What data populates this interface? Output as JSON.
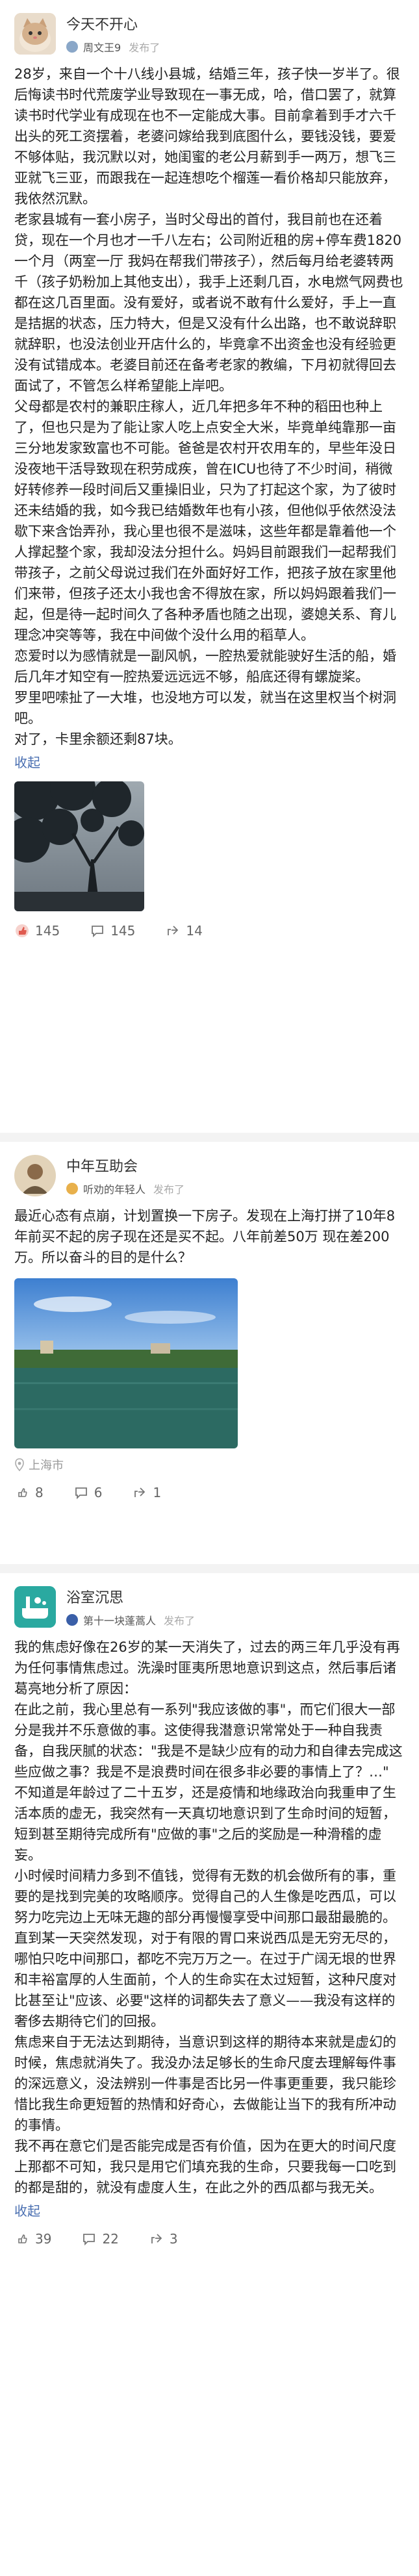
{
  "posts": [
    {
      "username": "今天不开心",
      "subtitle": "周文王9",
      "published": "发布了",
      "text": "28岁，来自一个十八线小县城，结婚三年，孩子快一岁半了。很后悔读书时代荒废学业导致现在一事无成，哈，借口罢了，就算读书时代学业有成现在也不一定能成大事。目前拿着到手才六千出头的死工资摆着，老婆问嫁给我到底图什么，要钱没钱，要爱不够体贴，我沉默以对，她闺蜜的老公月薪到手一两万，想飞三亚就飞三亚，而跟我在一起连想吃个榴莲一看价格却只能放弃，我依然沉默。\n老家县城有一套小房子，当时父母出的首付，我目前也在还着贷，现在一个月也才一千八左右；公司附近租的房+停车费1820一个月（两室一厅 我妈在帮我们带孩子），然后每月给老婆转两千（孩子奶粉加上其他支出），我手上还剩几百，水电燃气网费也都在这几百里面。没有爱好，或者说不敢有什么爱好，手上一直是拮据的状态，压力特大，但是又没有什么出路，也不敢说辞职就辞职，也没法创业开店什么的，毕竟拿不出资金也没有经验更没有试错成本。老婆目前还在备考老家的教编，下月初就得回去面试了，不管怎么样希望能上岸吧。\n父母都是农村的兼职庄稼人，近几年把多年不种的稻田也种上了，但也只是为了能让家人吃上点安全大米，毕竟单纯靠那一亩三分地发家致富也不可能。爸爸是农村开农用车的，早些年没日没夜地干活导致现在积劳成疾，曾在ICU也待了不少时间，稍微好转修养一段时间后又重操旧业，只为了打起这个家，为了彼时还未结婚的我，如今我已结婚数年也有小孩，但他似乎依然没法歇下来含饴弄孙，我心里也很不是滋味，这些年都是靠着他一个人撑起整个家，我却没法分担什么。妈妈目前跟我们一起帮我们带孩子，之前父母说过我们在外面好好工作，把孩子放在家里他们来带，但孩子还太小我也舍不得放在家，所以妈妈跟着我们一起，但是待一起时间久了各种矛盾也随之出现，婆媳关系、育儿理念冲突等等，我在中间做个没什么用的稻草人。\n恋爱时以为感情就是一副风帆，一腔热爱就能驶好生活的船，婚后几年才知空有一腔热爱远远远不够，船底还得有螺旋桨。\n罗里吧嗦扯了一大堆，也没地方可以发，就当在这里权当个树洞吧。\n对了，卡里余额还剩87块。",
      "fold_label": "收起",
      "location": "",
      "likes": "145",
      "comments": "145",
      "shares": "14"
    },
    {
      "username": "中年互助会",
      "subtitle": "听劝的年轻人",
      "published": "发布了",
      "text": "最近心态有点崩，计划置换一下房子。发现在上海打拼了10年8年前买不起的房子现在还是买不起。八年前差50万 现在差200万。所以奋斗的目的是什么？",
      "fold_label": "",
      "location": "上海市",
      "likes": "8",
      "comments": "6",
      "shares": "1"
    },
    {
      "username": "浴室沉思",
      "subtitle": "第十一块蓬蒿人",
      "published": "发布了",
      "text": "我的焦虑好像在26岁的某一天消失了，过去的两三年几乎没有再为任何事情焦虑过。洗澡时匪夷所思地意识到这点，然后事后诸葛亮地分析了原因：\n在此之前，我心里总有一系列\"我应该做的事\"，而它们很大一部分是我并不乐意做的事。这使得我潜意识常常处于一种自我责备，自我厌腻的状态：\"我是不是缺少应有的动力和自律去完成这些应做之事？我是不是浪费时间在很多非必要的事情上了？…\"\n不知道是年龄过了二十五岁，还是疫情和地缘政治向我重申了生活本质的虚无，我突然有一天真切地意识到了生命时间的短暂，短到甚至期待完成所有\"应做的事\"之后的奖励是一种滑稽的虚妄。\n小时候时间精力多到不值钱，觉得有无数的机会做所有的事，重要的是找到完美的攻略顺序。觉得自己的人生像是吃西瓜，可以努力吃完边上无味无趣的部分再慢慢享受中间那口最甜最脆的。\n直到某一天突然发现，对于有限的胃口来说西瓜是无穷无尽的，哪怕只吃中间那口，都吃不完万万之一。在过于广阔无垠的世界和丰裕富厚的人生面前，个人的生命实在太过短暂，这种尺度对比甚至让\"应该、必要\"这样的词都失去了意义——我没有这样的奢侈去期待它们的回报。\n焦虑来自于无法达到期待，当意识到这样的期待本来就是虚幻的时候，焦虑就消失了。我没办法足够长的生命尺度去理解每件事的深远意义，没法辨别一件事是否比另一件事更重要，我只能珍惜比我生命更短暂的热情和好奇心，去做能让当下的我有所冲动的事情。\n我不再在意它们是否能完成是否有价值，因为在更大的时间尺度上那都不可知，我只是用它们填充我的生命，只要我每一口吃到的都是甜的，就没有虚度人生，在此之外的西瓜都与我无关。",
      "fold_label": "收起",
      "location": "",
      "likes": "39",
      "comments": "22",
      "shares": "3"
    }
  ],
  "colors": {
    "link": "#4a6fb1",
    "like_red": "#e05a4f",
    "muted": "#999999"
  },
  "icons": [
    "like-icon",
    "comment-icon",
    "share-icon",
    "location-pin-icon"
  ]
}
